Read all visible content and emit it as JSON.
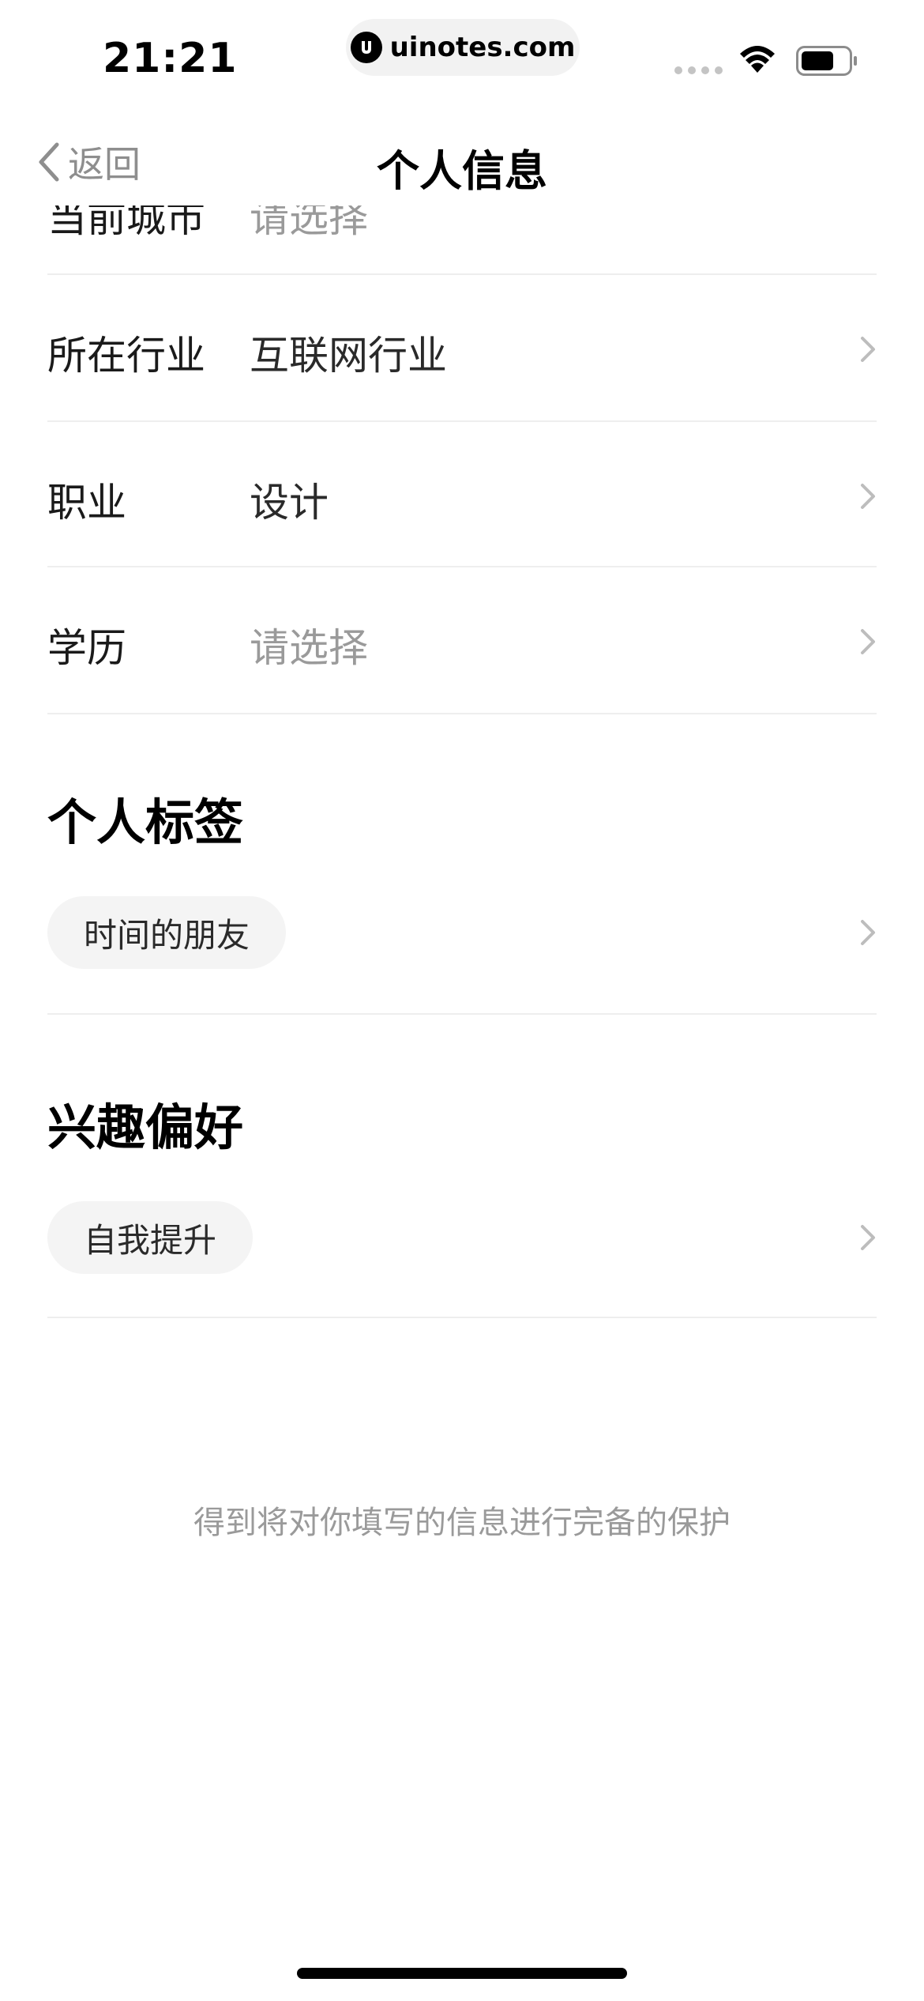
{
  "status_bar": {
    "time": "21:21",
    "url": "uinotes.com",
    "icons": [
      "signal-dots-icon",
      "wifi-icon",
      "battery-icon"
    ]
  },
  "nav": {
    "back_label": "返回",
    "title": "个人信息",
    "back_icon": "chevron-left-icon"
  },
  "partial_row": {
    "label": "当前城市",
    "value": "请选择"
  },
  "rows": [
    {
      "label": "所在行业",
      "value": "互联网行业",
      "placeholder": false
    },
    {
      "label": "职业",
      "value": "设计",
      "placeholder": false
    },
    {
      "label": "学历",
      "value": "请选择",
      "placeholder": true
    }
  ],
  "sections": {
    "tags": {
      "title": "个人标签",
      "items": [
        "时间的朋友"
      ]
    },
    "interests": {
      "title": "兴趣偏好",
      "items": [
        "自我提升"
      ]
    }
  },
  "footer_note": "得到将对你填写的信息进行完备的保护",
  "colors": {
    "text_primary": "#1a1a1a",
    "text_placeholder": "#9a9a9a",
    "divider": "#eeeeee",
    "pill_bg": "#f4f4f4",
    "chevron": "#bdbdbd"
  }
}
